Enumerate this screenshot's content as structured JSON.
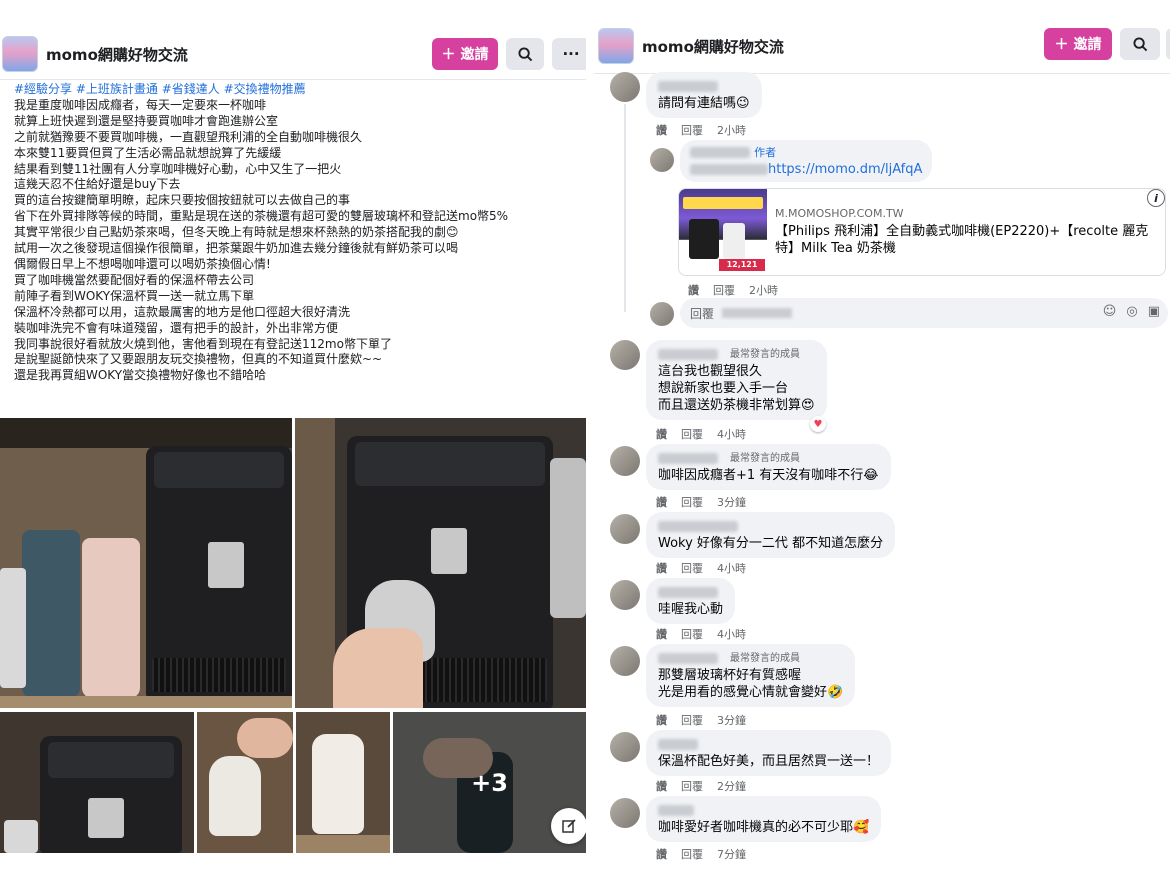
{
  "left": {
    "header": {
      "group_name": "momo網購好物交流",
      "invite_label": "邀請",
      "invite_icon": "plus-icon",
      "search_icon": "search-icon",
      "more_label": "···"
    },
    "post": {
      "hashtags": "#經驗分享 #上班族計畫通 #省錢達人 #交換禮物推薦",
      "lines": [
        "我是重度咖啡因成癮者，每天一定要來一杯咖啡",
        "就算上班快遲到還是堅持要買咖啡才會跑進辦公室",
        "之前就猶豫要不要買咖啡機，一直觀望飛利浦的全自動咖啡機很久",
        "本來雙11要買但買了生活必需品就想說算了先緩緩",
        "結果看到雙11社團有人分享咖啡機好心動，心中又生了一把火",
        "這幾天忍不住給好還是buy下去",
        "買的這台按鍵簡單明瞭，起床只要按個按鈕就可以去做自己的事",
        "省下在外買排隊等候的時間，重點是現在送的茶機還有超可愛的雙層玻璃杯和登記送mo幣5%",
        "其實平常很少自己點奶茶來喝，但冬天晚上有時就是想來杯熱熱的奶茶搭配我的劇😊",
        "試用一次之後發現這個操作很簡單，把茶葉跟牛奶加進去幾分鐘後就有鮮奶茶可以喝",
        "偶爾假日早上不想喝咖啡還可以喝奶茶換個心情!",
        "買了咖啡機當然要配個好看的保溫杯帶去公司",
        "前陣子看到WOKY保溫杯買一送一就立馬下單",
        "保溫杯冷熱都可以用，這款最厲害的地方是他口徑超大很好清洗",
        "裝咖啡洗完不會有味道殘留，還有把手的設計，外出非常方便",
        "我同事說很好看就放火燒到他，害他看到現在有登記送112mo幣下單了",
        "是說聖誕節快來了又要跟朋友玩交換禮物，但真的不知道買什麼欸~~",
        "還是我再買組WOKY當交換禮物好像也不錯哈哈"
      ],
      "more_photos": "+3",
      "edit_icon": "edit-icon"
    }
  },
  "right": {
    "header": {
      "group_name": "momo網購好物交流",
      "invite_label": "邀請",
      "invite_icon": "plus-icon",
      "search_icon": "search-icon"
    },
    "actions": {
      "like": "讚",
      "reply": "回覆"
    },
    "comments": [
      {
        "text": "請問有連結嗎😉",
        "time": "2小時"
      },
      {
        "author_tag": "作者",
        "link": "https://momo.dm/ljAfqA",
        "card_domain": "M.MOMOSHOP.COM.TW",
        "card_title": "【Philips 飛利浦】全自動義式咖啡機(EP2220)+【recolte 麗克特】Milk Tea 奶茶機",
        "card_price": "12,121",
        "time": "2小時"
      },
      {
        "reply_placeholder": "回覆"
      },
      {
        "badge": "最常發言的成員",
        "lines": [
          "這台我也觀望很久",
          "想說新家也要入手一台",
          "而且還送奶茶機非常划算😍"
        ],
        "time": "4小時"
      },
      {
        "badge": "最常發言的成員",
        "lines": [
          "咖啡因成癮者+1 有天沒有咖啡不行😂"
        ],
        "time": "3分鐘"
      },
      {
        "lines": [
          "Woky 好像有分一二代 都不知道怎麼分"
        ],
        "time": "4小時"
      },
      {
        "lines": [
          "哇喔我心動"
        ],
        "time": "4小時"
      },
      {
        "badge": "最常發言的成員",
        "lines": [
          "那雙層玻璃杯好有質感喔",
          "光是用看的感覺心情就會變好🤣"
        ],
        "time": "3分鐘"
      },
      {
        "lines": [
          "保溫杯配色好美，而且居然買一送一！"
        ],
        "time": "2分鐘"
      },
      {
        "lines": [
          "咖啡愛好者咖啡機真的必不可少耶🥰"
        ],
        "time": "7分鐘"
      }
    ]
  }
}
